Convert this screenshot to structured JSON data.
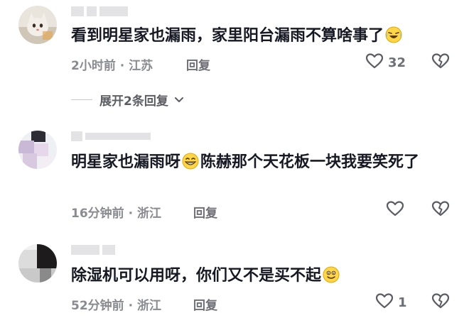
{
  "comments": [
    {
      "username": "",
      "content": "看到明星家也漏雨，家里阳台漏雨不算啥事了",
      "emoji": "laughing-tears-emoji",
      "time": "2小时前",
      "location": "江苏",
      "reply_label": "回复",
      "likes": "32"
    },
    {
      "username": "",
      "content_before": "明星家也漏雨呀",
      "emoji": "grin-emoji",
      "content_after": "陈赫那个天花板一块我要笑死了",
      "time": "16分钟前",
      "location": "浙江",
      "reply_label": "回复",
      "likes": ""
    },
    {
      "username": "",
      "content": "除湿机可以用呀，你们又不是买不起",
      "emoji": "smile-emoji",
      "time": "52分钟前",
      "location": "浙江",
      "reply_label": "回复",
      "likes": "1"
    }
  ],
  "expand_replies": {
    "prefix": "展开",
    "count": "2",
    "suffix": "条回复"
  },
  "meta_separator": "·",
  "colors": {
    "text": "#161823",
    "meta": "#8a8b91",
    "icon": "#5c5d63",
    "emoji_fill": "#ffd54a"
  }
}
